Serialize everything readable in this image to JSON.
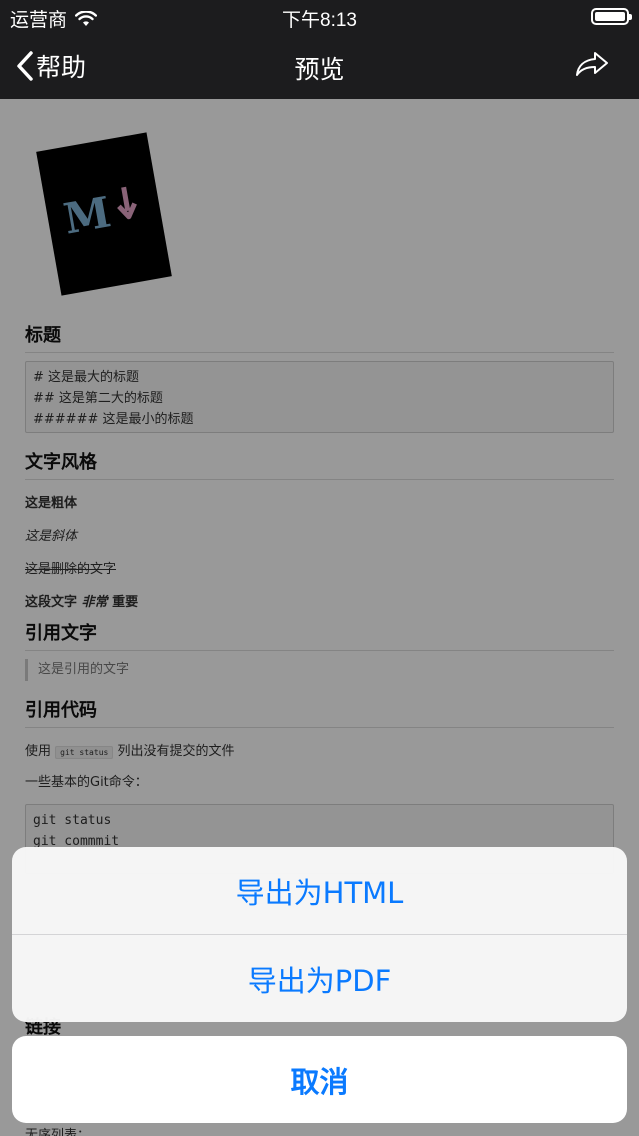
{
  "status_bar": {
    "carrier": "运营商",
    "time": "下午8:13"
  },
  "nav": {
    "back_label": "帮助",
    "title": "预览"
  },
  "doc": {
    "heading_section": {
      "title": "标题",
      "code_lines": [
        "#  这是最大的标题",
        "##  这是第二大的标题",
        "######  这是最小的标题"
      ]
    },
    "style_section": {
      "title": "文字风格",
      "bold": "这是粗体",
      "italic": "这是斜体",
      "strike": "这是删除的文字",
      "mixed_prefix": "这段文字",
      "mixed_emph": "非常",
      "mixed_suffix": "重要"
    },
    "quote_section": {
      "title": "引用文字",
      "quote": "这是引用的文字"
    },
    "code_section": {
      "title": "引用代码",
      "use_prefix": "使用",
      "inline_code": "git status",
      "use_suffix": "列出没有提交的文件",
      "git_intro": "一些基本的Git命令：",
      "code_lines": [
        "git status",
        "git commmit"
      ]
    },
    "link_section": {
      "title": "链接"
    },
    "list_intro": "无序列表："
  },
  "sheet": {
    "export_html": "导出为HTML",
    "export_pdf": "导出为PDF",
    "cancel": "取消"
  },
  "colors": {
    "accent": "#0a7aff",
    "bar": "#1c1c1e"
  }
}
